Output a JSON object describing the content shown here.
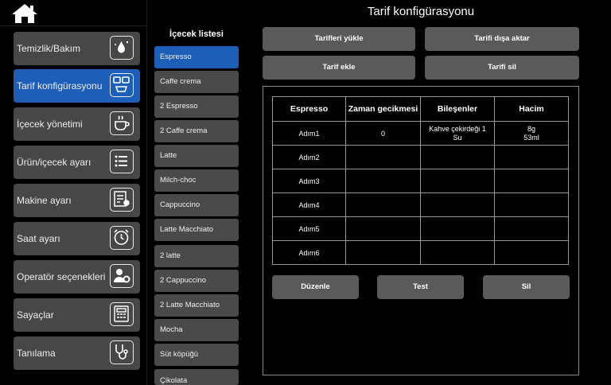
{
  "header": {
    "title": "Tarif konfigürasyonu"
  },
  "sidebar": {
    "items": [
      {
        "label": "Temizlik/Bakım",
        "icon": "cleaning-icon"
      },
      {
        "label": "Tarif konfigürasyonu",
        "icon": "recipe-icon"
      },
      {
        "label": "İçecek yönetimi",
        "icon": "coffee-cup-icon"
      },
      {
        "label": "Ürün/içecek ayarı",
        "icon": "list-icon"
      },
      {
        "label": "Makine ayarı",
        "icon": "machine-settings-icon"
      },
      {
        "label": "Saat ayarı",
        "icon": "clock-icon"
      },
      {
        "label": "Operatör seçenekleri",
        "icon": "operator-icon"
      },
      {
        "label": "Sayaçlar",
        "icon": "calculator-icon"
      },
      {
        "label": "Tanılama",
        "icon": "stethoscope-icon"
      }
    ],
    "active_index": 1
  },
  "drink_list": {
    "title": "İçecek listesi",
    "items": [
      "Espresso",
      "Caffe crema",
      "2 Espresso",
      "2 Caffe crema",
      "Latte",
      "Milch-choc",
      "Cappuccino",
      "Latte Macchiato",
      "2 latte",
      "2 Cappuccino",
      "2 Latte Macchiato",
      "Mocha",
      "Süt köpüğü",
      "Çikolata"
    ],
    "selected": "Espresso"
  },
  "toolbar": {
    "load": "Tarifleri yükle",
    "export": "Tarifi dışa aktar",
    "add": "Tarif ekle",
    "delete": "Tarifi sil"
  },
  "table": {
    "headers": [
      "Espresso",
      "Zaman gecikmesi",
      "Bileşenler",
      "Hacim"
    ],
    "rows": [
      [
        "Adım1",
        "0",
        "Kahve çekirdeği 1\nSu",
        "8g\n53ml"
      ],
      [
        "Adım2",
        "",
        "",
        ""
      ],
      [
        "Adım3",
        "",
        "",
        ""
      ],
      [
        "Adım4",
        "",
        "",
        ""
      ],
      [
        "Adım5",
        "",
        "",
        ""
      ],
      [
        "Adım6",
        "",
        "",
        ""
      ]
    ]
  },
  "actions": {
    "edit": "Düzenle",
    "test": "Test",
    "delete": "Sil"
  },
  "colors": {
    "active": "#1d5fb8",
    "button": "#5a5a5a",
    "item": "#474747"
  }
}
